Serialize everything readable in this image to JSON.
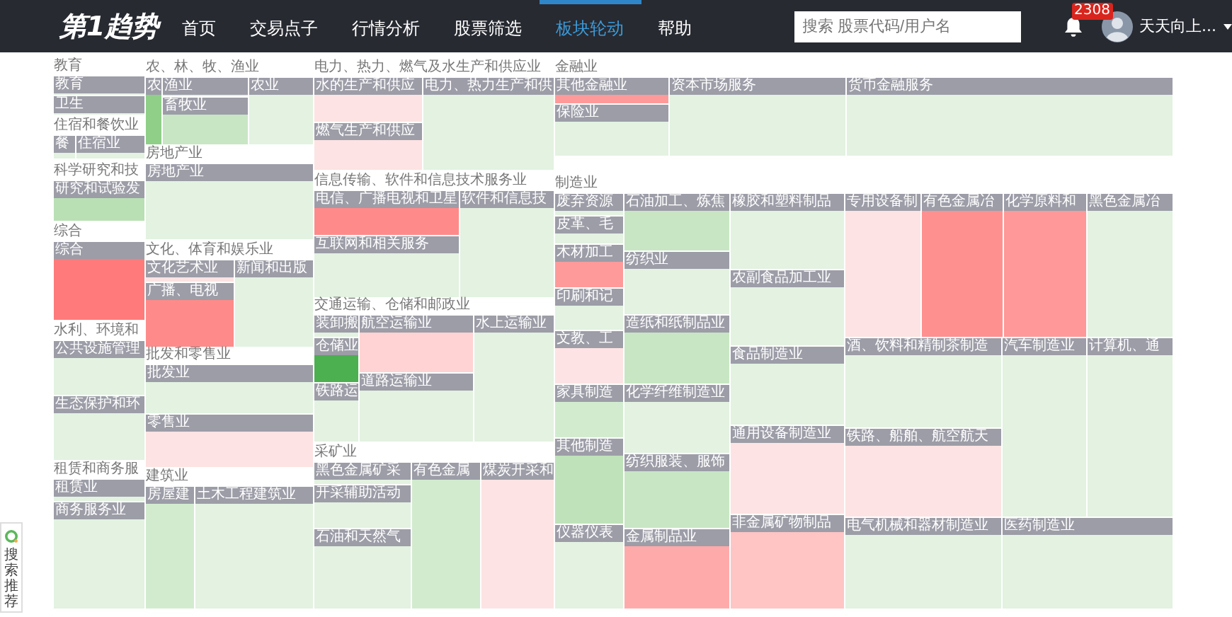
{
  "header": {
    "logo": "第1趋势",
    "nav": [
      {
        "label": "首页",
        "selected": false
      },
      {
        "label": "交易点子",
        "selected": false
      },
      {
        "label": "行情分析",
        "selected": false
      },
      {
        "label": "股票筛选",
        "selected": false
      },
      {
        "label": "板块轮动",
        "selected": true
      },
      {
        "label": "帮助",
        "selected": false
      }
    ],
    "search": {
      "placeholder": "搜索 股票代码/用户名"
    },
    "notifications": {
      "count": "2308"
    },
    "user": {
      "name": "天天向上..."
    }
  },
  "treemap": {
    "groups": [
      {
        "title": "教育",
        "tiles": [
          {
            "label": "教育",
            "color": "#e3f2e1"
          },
          {
            "label": "卫生",
            "color": "#e3f2e1"
          }
        ]
      },
      {
        "title": "住宿和餐饮业",
        "tiles": [
          {
            "label": "餐",
            "color": "#e3f2e1"
          },
          {
            "label": "住宿业",
            "color": "#e3f2e1"
          }
        ]
      },
      {
        "title": "科学研究和技",
        "tiles": [
          {
            "label": "研究和试验发",
            "color": "#b9e0b4"
          }
        ]
      },
      {
        "title": "综合",
        "tiles": [
          {
            "label": "综合",
            "color": "#ff7a7a"
          }
        ]
      },
      {
        "title": "水利、环境和",
        "tiles": [
          {
            "label": "公共设施管理",
            "color": "#e3f2e1"
          },
          {
            "label": "生态保护和环",
            "color": "#e3f2e1"
          }
        ]
      },
      {
        "title": "租赁和商务服",
        "tiles": [
          {
            "label": "租赁业",
            "color": "#e3f2e1"
          },
          {
            "label": "商务服务业",
            "color": "#e3f2e1"
          }
        ]
      },
      {
        "title": "农、林、牧、渔业",
        "tiles": [
          {
            "label": "农",
            "color": "#8fcf88"
          },
          {
            "label": "渔业",
            "color": "#e3f2e1"
          },
          {
            "label": "畜牧业",
            "color": "#c8e6c4"
          },
          {
            "label": "农业",
            "color": "#e3f2e1"
          }
        ]
      },
      {
        "title": "房地产业",
        "tiles": [
          {
            "label": "房地产业",
            "color": "#e3f2e1"
          }
        ]
      },
      {
        "title": "文化、体育和娱乐业",
        "tiles": [
          {
            "label": "文化艺术业",
            "color": "#fde3e3"
          },
          {
            "label": "广播、电视",
            "color": "#ff8a8a"
          },
          {
            "label": "新闻和出版",
            "color": "#e3f2e1"
          }
        ]
      },
      {
        "title": "批发和零售业",
        "tiles": [
          {
            "label": "批发业",
            "color": "#e3f2e1"
          },
          {
            "label": "零售业",
            "color": "#fde3e3"
          }
        ]
      },
      {
        "title": "建筑业",
        "tiles": [
          {
            "label": "房屋建",
            "color": "#d2ebcf"
          },
          {
            "label": "土木工程建筑业",
            "color": "#e3f2e1"
          }
        ]
      },
      {
        "title": "电力、热力、燃气及水生产和供应业",
        "tiles": [
          {
            "label": "水的生产和供应",
            "color": "#fde3e3"
          },
          {
            "label": "燃气生产和供应",
            "color": "#fde3e3"
          },
          {
            "label": "电力、热力生产和供",
            "color": "#e3f2e1"
          }
        ]
      },
      {
        "title": "信息传输、软件和信息技术服务业",
        "tiles": [
          {
            "label": "电信、广播电视和卫星",
            "color": "#ff8a8a"
          },
          {
            "label": "互联网和相关服务",
            "color": "#e3f2e1"
          },
          {
            "label": "软件和信息技",
            "color": "#e3f2e1"
          }
        ]
      },
      {
        "title": "交通运输、仓储和邮政业",
        "tiles": [
          {
            "label": "装卸搬",
            "color": "#e3f2e1"
          },
          {
            "label": "仓储业",
            "color": "#4caf50"
          },
          {
            "label": "铁路运",
            "color": "#e3f2e1"
          },
          {
            "label": "航空运输业",
            "color": "#ffd3d3"
          },
          {
            "label": "道路运输业",
            "color": "#e3f2e1"
          },
          {
            "label": "水上运输业",
            "color": "#e3f2e1"
          }
        ]
      },
      {
        "title": "采矿业",
        "tiles": [
          {
            "label": "黑色金属矿采",
            "color": "#e3f2e1"
          },
          {
            "label": "开采辅助活动",
            "color": "#e3f2e1"
          },
          {
            "label": "石油和天然气",
            "color": "#e3f2e1"
          },
          {
            "label": "有色金属",
            "color": "#d2ebcf"
          },
          {
            "label": "煤炭开采和",
            "color": "#fde3e3"
          }
        ]
      },
      {
        "title": "金融业",
        "tiles": [
          {
            "label": "其他金融业",
            "color": "#ff9a9a"
          },
          {
            "label": "保险业",
            "color": "#e3f2e1"
          },
          {
            "label": "资本市场服务",
            "color": "#e3f2e1"
          },
          {
            "label": "货币金融服务",
            "color": "#e3f2e1"
          }
        ]
      },
      {
        "title": "制造业",
        "tiles": [
          {
            "label": "废弃资源",
            "color": "#e3f2e1"
          },
          {
            "label": "皮革、毛",
            "color": "#e3f2e1"
          },
          {
            "label": "木材加工",
            "color": "#ff9a9a"
          },
          {
            "label": "印刷和记",
            "color": "#e3f2e1"
          },
          {
            "label": "文教、工",
            "color": "#fde3e3"
          },
          {
            "label": "家具制造",
            "color": "#d2ebcf"
          },
          {
            "label": "其他制造",
            "color": "#bfe2ba"
          },
          {
            "label": "仪器仪表",
            "color": "#e3f2e1"
          },
          {
            "label": "石油加工、炼焦",
            "color": "#c8e6c4"
          },
          {
            "label": "纺织业",
            "color": "#e3f2e1"
          },
          {
            "label": "造纸和纸制品业",
            "color": "#c8e6c4"
          },
          {
            "label": "化学纤维制造业",
            "color": "#e3f2e1"
          },
          {
            "label": "纺织服装、服饰",
            "color": "#c8e6c4"
          },
          {
            "label": "金属制品业",
            "color": "#ffaaaa"
          },
          {
            "label": "橡胶和塑料制品",
            "color": "#e3f2e1"
          },
          {
            "label": "农副食品加工业",
            "color": "#e3f2e1"
          },
          {
            "label": "食品制造业",
            "color": "#e3f2e1"
          },
          {
            "label": "通用设备制造业",
            "color": "#fde3e3"
          },
          {
            "label": "非金属矿物制品",
            "color": "#ffc4c4"
          },
          {
            "label": "专用设备制",
            "color": "#fde3e3"
          },
          {
            "label": "有色金属冶",
            "color": "#ff9090"
          },
          {
            "label": "化学原料和",
            "color": "#ff9898"
          },
          {
            "label": "黑色金属冶",
            "color": "#e3f2e1"
          },
          {
            "label": "酒、饮料和精制茶制造",
            "color": "#e3f2e1"
          },
          {
            "label": "铁路、船舶、航空航天",
            "color": "#fde3e3"
          },
          {
            "label": "汽车制造业",
            "color": "#e3f2e1"
          },
          {
            "label": "计算机、通",
            "color": "#e3f2e1"
          },
          {
            "label": "电气机械和器材制造业",
            "color": "#e3f2e1"
          },
          {
            "label": "医药制造业",
            "color": "#e3f2e1"
          }
        ]
      }
    ]
  },
  "side_widget": {
    "label": "搜索推荐"
  }
}
